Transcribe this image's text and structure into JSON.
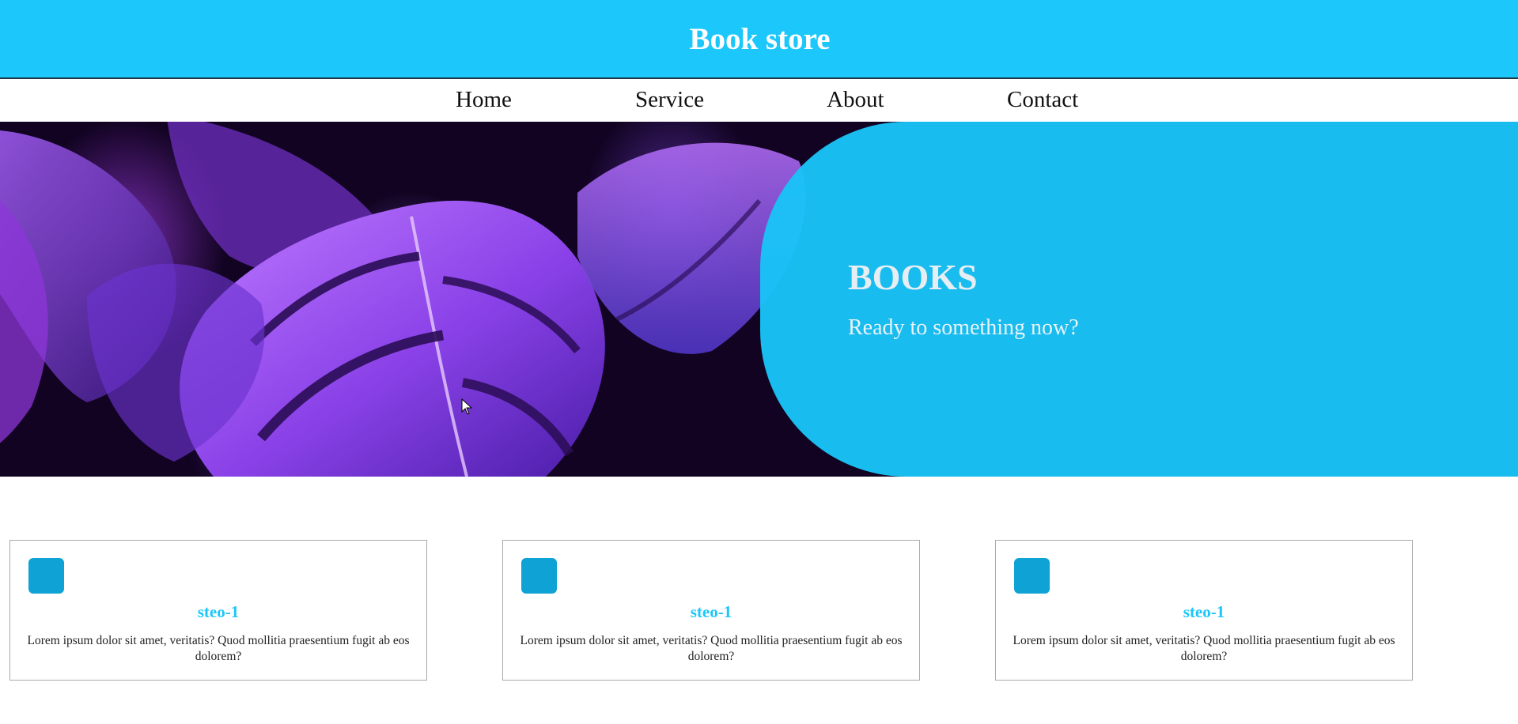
{
  "header": {
    "title": "Book store",
    "background_color": "#1bc7fb"
  },
  "nav": {
    "items": [
      {
        "label": "Home"
      },
      {
        "label": "Service"
      },
      {
        "label": "About"
      },
      {
        "label": "Contact"
      }
    ]
  },
  "hero": {
    "heading": "BOOKS",
    "subtext": "Ready to something now?",
    "image_description": "purple-monstera-leaves",
    "panel_color": "#19c4f8"
  },
  "cards": [
    {
      "icon": "square-icon",
      "title": "steo-1",
      "text": "Lorem ipsum dolor sit amet, veritatis? Quod mollitia praesentium fugit ab eos dolorem?"
    },
    {
      "icon": "square-icon",
      "title": "steo-1",
      "text": "Lorem ipsum dolor sit amet, veritatis? Quod mollitia praesentium fugit ab eos dolorem?"
    },
    {
      "icon": "square-icon",
      "title": "steo-1",
      "text": "Lorem ipsum dolor sit amet, veritatis? Quod mollitia praesentium fugit ab eos dolorem?"
    }
  ],
  "colors": {
    "accent": "#1bc7fb",
    "icon": "#0ea3d4",
    "card_border": "#a9a9a9"
  }
}
